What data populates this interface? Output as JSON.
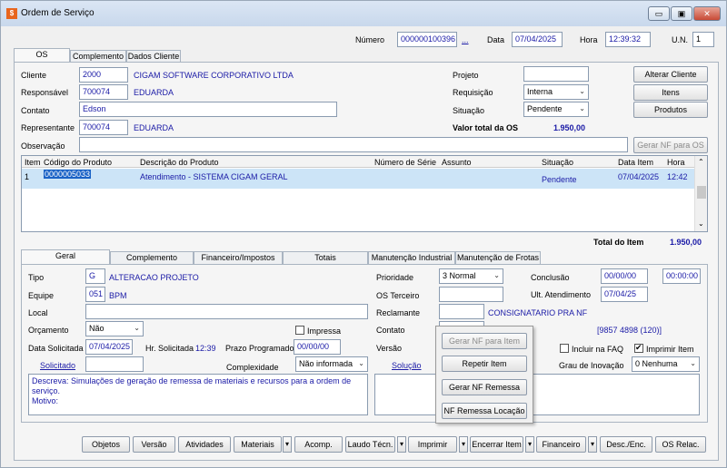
{
  "window": {
    "title": "Ordem de Serviço",
    "icon": "app-icon",
    "min": "▭",
    "max": "▣",
    "close": "✕"
  },
  "top": {
    "numero_label": "Número",
    "numero": "000000100396",
    "ellipsis": "...",
    "data_label": "Data",
    "data": "07/04/2025",
    "hora_label": "Hora",
    "hora": "12:39:32",
    "un_label": "U.N.",
    "un": "1"
  },
  "tabs": [
    {
      "label": "OS"
    },
    {
      "label": "Complemento"
    },
    {
      "label": "Dados Cliente"
    }
  ],
  "cliente": {
    "label": "Cliente",
    "code": "2000",
    "name": "CIGAM SOFTWARE CORPORATIVO LTDA"
  },
  "responsavel": {
    "label": "Responsável",
    "code": "700074",
    "name": "EDUARDA"
  },
  "contato": {
    "label": "Contato",
    "value": "Edson"
  },
  "representante": {
    "label": "Representante",
    "code": "700074",
    "name": "EDUARDA"
  },
  "observacao": {
    "label": "Observação",
    "value": ""
  },
  "projeto": {
    "label": "Projeto",
    "value": ""
  },
  "requisicao": {
    "label": "Requisição",
    "value": "Interna"
  },
  "situacao": {
    "label": "Situação",
    "value": "Pendente"
  },
  "valor_total": {
    "label": "Valor total da OS",
    "value": "1.950,00"
  },
  "buttons_right": {
    "alterar": "Alterar Cliente",
    "itens": "Itens",
    "produtos": "Produtos",
    "gerar_nf": "Gerar NF para OS"
  },
  "items_table": {
    "headers": [
      "Item",
      "Código do Produto",
      "Descrição do Produto",
      "Número de Série",
      "Assunto",
      "Situação",
      "Data Item",
      "Hora"
    ],
    "rows": [
      {
        "item": "1",
        "codigo": "0000005033",
        "descricao": "Atendimento - SISTEMA CIGAM GERAL",
        "serie": "",
        "assunto": "",
        "situacao": "Pendente",
        "data": "07/04/2025",
        "hora": "12:42"
      }
    ]
  },
  "total_item": {
    "label": "Total do Item",
    "value": "1.950,00"
  },
  "subtabs": [
    {
      "label": "Geral"
    },
    {
      "label": "Complemento"
    },
    {
      "label": "Financeiro/Impostos"
    },
    {
      "label": "Totais"
    },
    {
      "label": "Manutenção Industrial"
    },
    {
      "label": "Manutenção de Frotas"
    }
  ],
  "geral": {
    "tipo": {
      "label": "Tipo",
      "code": "G",
      "name": "ALTERACAO PROJETO"
    },
    "equipe": {
      "label": "Equipe",
      "code": "051",
      "name": "BPM"
    },
    "local": {
      "label": "Local",
      "value": ""
    },
    "orcamento": {
      "label": "Orçamento",
      "value": "Não"
    },
    "impressa": {
      "label": "Impressa",
      "checked": false
    },
    "data_solicitada": {
      "label": "Data Solicitada",
      "value": "07/04/2025"
    },
    "hr_solicitada": {
      "label": "Hr. Solicitada",
      "value": "12:39"
    },
    "prazo": {
      "label": "Prazo Programado",
      "value": "00/00/00"
    },
    "solicitado": {
      "label": "Solicitado",
      "value": ""
    },
    "complexidade": {
      "label": "Complexidade",
      "value": "Não informada"
    },
    "descreva": "Descreva: Simulações de geração de remessa de materiais e recursos para a ordem de serviço.\nMotivo:",
    "prioridade": {
      "label": "Prioridade",
      "value": "3 Normal"
    },
    "os_terceiro": {
      "label": "OS Terceiro",
      "value": ""
    },
    "reclamante": {
      "label": "Reclamante",
      "value": "",
      "name": "CONSIGNATARIO PRA NF"
    },
    "contato": {
      "label": "Contato",
      "value": "",
      "phone": "[9857 4898 (120)]"
    },
    "versao": {
      "label": "Versão"
    },
    "solucao": {
      "label": "Solução"
    },
    "conclusao": {
      "label": "Conclusão",
      "date": "00/00/00",
      "time": "00:00:00"
    },
    "ult_atendimento": {
      "label": "Ult. Atendimento",
      "value": "07/04/25"
    },
    "incluir_faq": {
      "label": "Incluir na FAQ",
      "checked": false
    },
    "imprimir_item": {
      "label": "Imprimir Item",
      "checked": true
    },
    "grau_inovacao": {
      "label": "Grau de Inovação",
      "value": "0 Nenhuma"
    }
  },
  "popup_menu": [
    "Gerar NF para Item",
    "Repetir Item",
    "Gerar NF Remessa",
    "NF Remessa Locação"
  ],
  "bottom_buttons": [
    "Objetos",
    "Versão",
    "Atividades",
    "Materiais",
    "Acomp.",
    "Laudo Técn.",
    "Imprimir",
    "Encerrar Item",
    "Financeiro",
    "Desc./Enc.",
    "OS Relac."
  ],
  "colors": {
    "value_blue": "#1a1aa6",
    "selection": "#cce4f7"
  }
}
